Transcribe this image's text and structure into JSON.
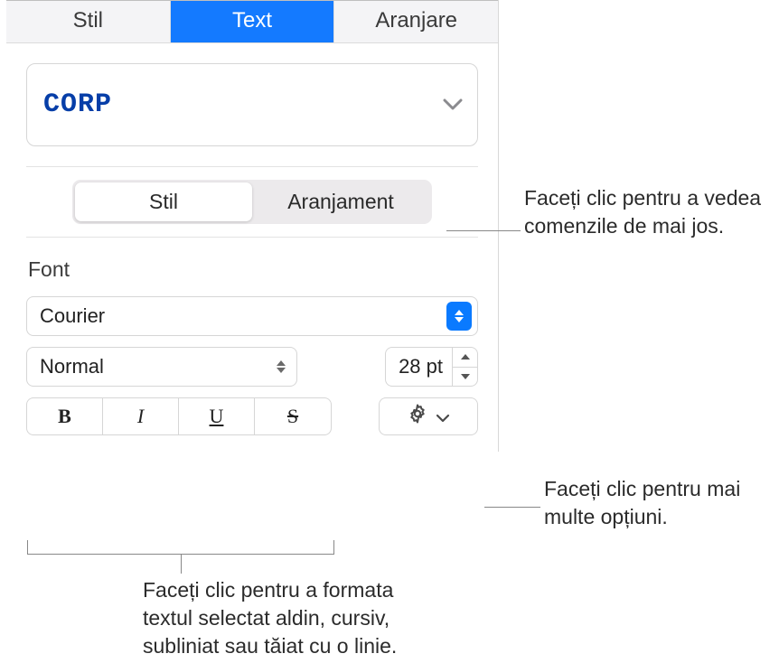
{
  "tabs": {
    "style": "Stil",
    "text": "Text",
    "arrange": "Aranjare"
  },
  "paragraph_style": "CORP",
  "sub_tabs": {
    "style": "Stil",
    "layout": "Aranjament"
  },
  "font": {
    "section_label": "Font",
    "family": "Courier",
    "weight": "Normal",
    "size": "28 pt"
  },
  "bius": {
    "bold": "B",
    "italic": "I",
    "underline": "U",
    "strike": "S"
  },
  "callouts": {
    "subtabs": "Faceți clic pentru a vedea comenzile de mai jos.",
    "gear": "Faceți clic pentru mai multe opțiuni.",
    "bius": "Faceți clic pentru a formata textul selectat aldin, cursiv, subliniat sau tăiat cu o linie."
  }
}
